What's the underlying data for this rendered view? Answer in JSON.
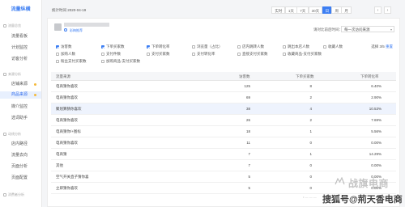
{
  "sidebar": {
    "brand": "流量纵横",
    "groups": [
      {
        "title": "流量总览",
        "items": [
          {
            "label": "流量看板"
          },
          {
            "label": "计划监控"
          },
          {
            "label": "访客分析"
          }
        ]
      },
      {
        "title": "来源分析",
        "items": [
          {
            "label": "店铺来源"
          },
          {
            "label": "商品来源"
          },
          {
            "label": "媒介监控"
          },
          {
            "label": "选词助手"
          }
        ]
      },
      {
        "title": "动线分析",
        "items": [
          {
            "label": "店内路径"
          },
          {
            "label": "流量去向"
          },
          {
            "label": "页面分析"
          },
          {
            "label": "页面配置"
          }
        ]
      },
      {
        "title": "消费者分析",
        "items": []
      }
    ],
    "active_item": "商品来源"
  },
  "topbar": {
    "stat_time": "统计时间 2020-04-19",
    "periods": [
      "实时",
      "1天",
      "7天",
      "30天",
      "日",
      "周",
      "月"
    ],
    "active_period": "日",
    "prev_arrow": "‹",
    "next_arrow": "›"
  },
  "shop": {
    "sub_label": "彩梅推荐"
  },
  "compare": {
    "label": "请对比前后时间：",
    "value": "每一次访问来源",
    "caret": "▾"
  },
  "filters": {
    "row1": [
      {
        "label": "访客数",
        "checked": true
      },
      {
        "label": "下单买家数",
        "checked": true
      },
      {
        "label": "下单转化率",
        "checked": true
      },
      {
        "label": "浏览量（占比）",
        "checked": false
      },
      {
        "label": "店内跳转人数",
        "checked": false
      },
      {
        "label": "跳出本店人数",
        "checked": false
      },
      {
        "label": "收藏人数",
        "checked": false
      }
    ],
    "row2": [
      {
        "label": "加购人数",
        "checked": false
      },
      {
        "label": "支付件数",
        "checked": false
      },
      {
        "label": "支付买家数",
        "checked": false
      },
      {
        "label": "支付转化率",
        "checked": false
      },
      {
        "label": "直接支付买家数",
        "checked": false
      },
      {
        "label": "收藏商品-支付买家数",
        "checked": false
      }
    ],
    "row3": [
      {
        "label": "粉丝支付买家数",
        "checked": false
      },
      {
        "label": "加购商品-支付买家数",
        "checked": false
      }
    ],
    "chosen_prefix": "选择",
    "chosen_count": "3/5",
    "chosen_action": "重置"
  },
  "table": {
    "headers": [
      "流量来源",
      "访客数",
      "下单买家数",
      "下单转化率"
    ],
    "rows": [
      {
        "source": "电商猜你喜欢",
        "visitors": "125",
        "buyers": "8",
        "rate": "6.40%",
        "highlight": false
      },
      {
        "source": "电商猜你喜欢",
        "visitors": "69",
        "buyers": "2",
        "rate": "2.90%",
        "highlight": false
      },
      {
        "source": "聚划算猜你喜欢",
        "visitors": "38",
        "buyers": "4",
        "rate": "10.53%",
        "highlight": true
      },
      {
        "source": "电商猜你喜欢",
        "visitors": "26",
        "buyers": "2",
        "rate": "7.69%",
        "highlight": false
      },
      {
        "source": "电商猜你/+图标",
        "visitors": "18",
        "buyers": "1",
        "rate": "5.56%",
        "highlight": false
      },
      {
        "source": "电商猜你喜欢",
        "visitors": "11",
        "buyers": "0",
        "rate": "0.00%",
        "highlight": false
      },
      {
        "source": "电商猜",
        "visitors": "7",
        "buyers": "1",
        "rate": "14.29%",
        "highlight": false
      },
      {
        "source": "其他",
        "visitors": "7",
        "buyers": "0",
        "rate": "0.00%",
        "highlight": false
      },
      {
        "source": "空气开关直子猜你喜",
        "visitors": "5",
        "buyers": "0",
        "rate": "0.00%",
        "highlight": false
      },
      {
        "source": "立即猜你喜欢",
        "visitors": "5",
        "buyers": "0",
        "rate": "0.00%",
        "highlight": false
      }
    ]
  },
  "watermark": {
    "brand": "战旗电商",
    "author": "搜狐号@荊天香电商",
    "dots": "•  —  —  —"
  },
  "colors": {
    "accent": "#3c7ef3",
    "highlight_row": "#eef3fd",
    "warning_dot": "#f5b93a"
  }
}
